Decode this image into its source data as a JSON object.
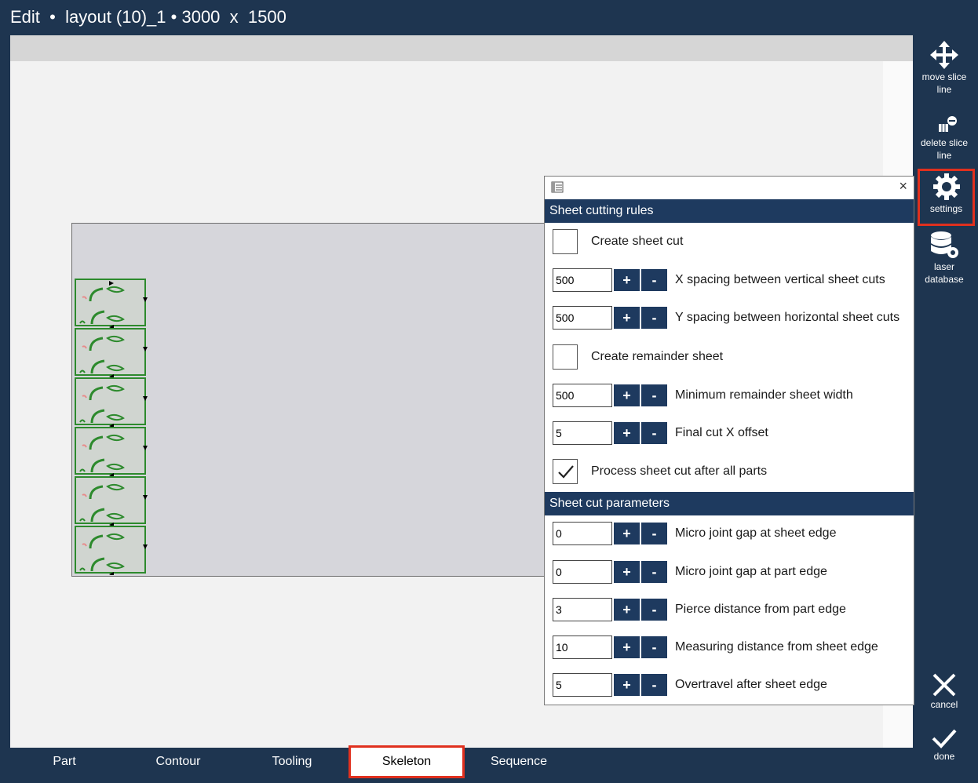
{
  "titlebar": {
    "mode": "Edit",
    "sep1": "•",
    "layout": "layout (10)_1",
    "sep2": "•",
    "width": "3000",
    "x": "x",
    "height": "1500"
  },
  "tools": {
    "move_slice_line": "move slice line",
    "delete_slice_line": "delete slice line",
    "settings": "settings",
    "laser_database": "laser database",
    "cancel": "cancel",
    "done": "done"
  },
  "dialog": {
    "close": "×",
    "section1": "Sheet cutting rules",
    "section2": "Sheet cut parameters",
    "create_sheet_cut": {
      "label": "Create sheet cut",
      "checked": false
    },
    "x_spacing": {
      "value": "500",
      "label": "X spacing between vertical sheet cuts"
    },
    "y_spacing": {
      "value": "500",
      "label": "Y spacing between horizontal sheet cuts"
    },
    "create_remainder": {
      "label": "Create remainder sheet",
      "checked": false
    },
    "min_remainder": {
      "value": "500",
      "label": "Minimum remainder sheet width"
    },
    "final_cut_x": {
      "value": "5",
      "label": "Final cut X offset"
    },
    "process_after": {
      "label": "Process sheet cut after all parts",
      "checked": true
    },
    "micro_sheet_edge": {
      "value": "0",
      "label": "Micro joint gap at sheet edge"
    },
    "micro_part_edge": {
      "value": "0",
      "label": "Micro joint gap at part edge"
    },
    "pierce_distance": {
      "value": "3",
      "label": "Pierce distance from part edge"
    },
    "measuring_distance": {
      "value": "10",
      "label": "Measuring distance from sheet edge"
    },
    "overtravel": {
      "value": "5",
      "label": "Overtravel after sheet edge"
    },
    "plus": "+",
    "minus": "-"
  },
  "tabs": [
    "Part",
    "Contour",
    "Tooling",
    "Skeleton",
    "Sequence"
  ],
  "active_tab": "Skeleton",
  "colors": {
    "background": "#1e3550",
    "section": "#1e3a5f",
    "highlight": "#e0301e",
    "part_outline": "#2d8a2d"
  }
}
